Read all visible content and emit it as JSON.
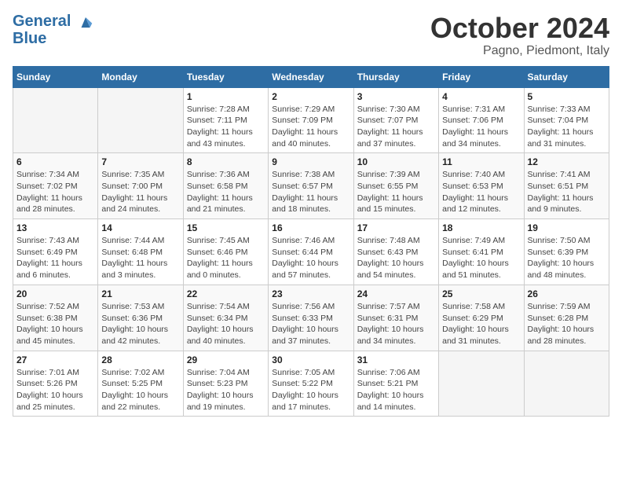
{
  "header": {
    "logo_line1": "General",
    "logo_line2": "Blue",
    "month_title": "October 2024",
    "location": "Pagno, Piedmont, Italy"
  },
  "weekdays": [
    "Sunday",
    "Monday",
    "Tuesday",
    "Wednesday",
    "Thursday",
    "Friday",
    "Saturday"
  ],
  "weeks": [
    [
      {
        "day": null
      },
      {
        "day": null
      },
      {
        "day": "1",
        "sunrise": "Sunrise: 7:28 AM",
        "sunset": "Sunset: 7:11 PM",
        "daylight": "Daylight: 11 hours and 43 minutes."
      },
      {
        "day": "2",
        "sunrise": "Sunrise: 7:29 AM",
        "sunset": "Sunset: 7:09 PM",
        "daylight": "Daylight: 11 hours and 40 minutes."
      },
      {
        "day": "3",
        "sunrise": "Sunrise: 7:30 AM",
        "sunset": "Sunset: 7:07 PM",
        "daylight": "Daylight: 11 hours and 37 minutes."
      },
      {
        "day": "4",
        "sunrise": "Sunrise: 7:31 AM",
        "sunset": "Sunset: 7:06 PM",
        "daylight": "Daylight: 11 hours and 34 minutes."
      },
      {
        "day": "5",
        "sunrise": "Sunrise: 7:33 AM",
        "sunset": "Sunset: 7:04 PM",
        "daylight": "Daylight: 11 hours and 31 minutes."
      }
    ],
    [
      {
        "day": "6",
        "sunrise": "Sunrise: 7:34 AM",
        "sunset": "Sunset: 7:02 PM",
        "daylight": "Daylight: 11 hours and 28 minutes."
      },
      {
        "day": "7",
        "sunrise": "Sunrise: 7:35 AM",
        "sunset": "Sunset: 7:00 PM",
        "daylight": "Daylight: 11 hours and 24 minutes."
      },
      {
        "day": "8",
        "sunrise": "Sunrise: 7:36 AM",
        "sunset": "Sunset: 6:58 PM",
        "daylight": "Daylight: 11 hours and 21 minutes."
      },
      {
        "day": "9",
        "sunrise": "Sunrise: 7:38 AM",
        "sunset": "Sunset: 6:57 PM",
        "daylight": "Daylight: 11 hours and 18 minutes."
      },
      {
        "day": "10",
        "sunrise": "Sunrise: 7:39 AM",
        "sunset": "Sunset: 6:55 PM",
        "daylight": "Daylight: 11 hours and 15 minutes."
      },
      {
        "day": "11",
        "sunrise": "Sunrise: 7:40 AM",
        "sunset": "Sunset: 6:53 PM",
        "daylight": "Daylight: 11 hours and 12 minutes."
      },
      {
        "day": "12",
        "sunrise": "Sunrise: 7:41 AM",
        "sunset": "Sunset: 6:51 PM",
        "daylight": "Daylight: 11 hours and 9 minutes."
      }
    ],
    [
      {
        "day": "13",
        "sunrise": "Sunrise: 7:43 AM",
        "sunset": "Sunset: 6:49 PM",
        "daylight": "Daylight: 11 hours and 6 minutes."
      },
      {
        "day": "14",
        "sunrise": "Sunrise: 7:44 AM",
        "sunset": "Sunset: 6:48 PM",
        "daylight": "Daylight: 11 hours and 3 minutes."
      },
      {
        "day": "15",
        "sunrise": "Sunrise: 7:45 AM",
        "sunset": "Sunset: 6:46 PM",
        "daylight": "Daylight: 11 hours and 0 minutes."
      },
      {
        "day": "16",
        "sunrise": "Sunrise: 7:46 AM",
        "sunset": "Sunset: 6:44 PM",
        "daylight": "Daylight: 10 hours and 57 minutes."
      },
      {
        "day": "17",
        "sunrise": "Sunrise: 7:48 AM",
        "sunset": "Sunset: 6:43 PM",
        "daylight": "Daylight: 10 hours and 54 minutes."
      },
      {
        "day": "18",
        "sunrise": "Sunrise: 7:49 AM",
        "sunset": "Sunset: 6:41 PM",
        "daylight": "Daylight: 10 hours and 51 minutes."
      },
      {
        "day": "19",
        "sunrise": "Sunrise: 7:50 AM",
        "sunset": "Sunset: 6:39 PM",
        "daylight": "Daylight: 10 hours and 48 minutes."
      }
    ],
    [
      {
        "day": "20",
        "sunrise": "Sunrise: 7:52 AM",
        "sunset": "Sunset: 6:38 PM",
        "daylight": "Daylight: 10 hours and 45 minutes."
      },
      {
        "day": "21",
        "sunrise": "Sunrise: 7:53 AM",
        "sunset": "Sunset: 6:36 PM",
        "daylight": "Daylight: 10 hours and 42 minutes."
      },
      {
        "day": "22",
        "sunrise": "Sunrise: 7:54 AM",
        "sunset": "Sunset: 6:34 PM",
        "daylight": "Daylight: 10 hours and 40 minutes."
      },
      {
        "day": "23",
        "sunrise": "Sunrise: 7:56 AM",
        "sunset": "Sunset: 6:33 PM",
        "daylight": "Daylight: 10 hours and 37 minutes."
      },
      {
        "day": "24",
        "sunrise": "Sunrise: 7:57 AM",
        "sunset": "Sunset: 6:31 PM",
        "daylight": "Daylight: 10 hours and 34 minutes."
      },
      {
        "day": "25",
        "sunrise": "Sunrise: 7:58 AM",
        "sunset": "Sunset: 6:29 PM",
        "daylight": "Daylight: 10 hours and 31 minutes."
      },
      {
        "day": "26",
        "sunrise": "Sunrise: 7:59 AM",
        "sunset": "Sunset: 6:28 PM",
        "daylight": "Daylight: 10 hours and 28 minutes."
      }
    ],
    [
      {
        "day": "27",
        "sunrise": "Sunrise: 7:01 AM",
        "sunset": "Sunset: 5:26 PM",
        "daylight": "Daylight: 10 hours and 25 minutes."
      },
      {
        "day": "28",
        "sunrise": "Sunrise: 7:02 AM",
        "sunset": "Sunset: 5:25 PM",
        "daylight": "Daylight: 10 hours and 22 minutes."
      },
      {
        "day": "29",
        "sunrise": "Sunrise: 7:04 AM",
        "sunset": "Sunset: 5:23 PM",
        "daylight": "Daylight: 10 hours and 19 minutes."
      },
      {
        "day": "30",
        "sunrise": "Sunrise: 7:05 AM",
        "sunset": "Sunset: 5:22 PM",
        "daylight": "Daylight: 10 hours and 17 minutes."
      },
      {
        "day": "31",
        "sunrise": "Sunrise: 7:06 AM",
        "sunset": "Sunset: 5:21 PM",
        "daylight": "Daylight: 10 hours and 14 minutes."
      },
      {
        "day": null
      },
      {
        "day": null
      }
    ]
  ]
}
